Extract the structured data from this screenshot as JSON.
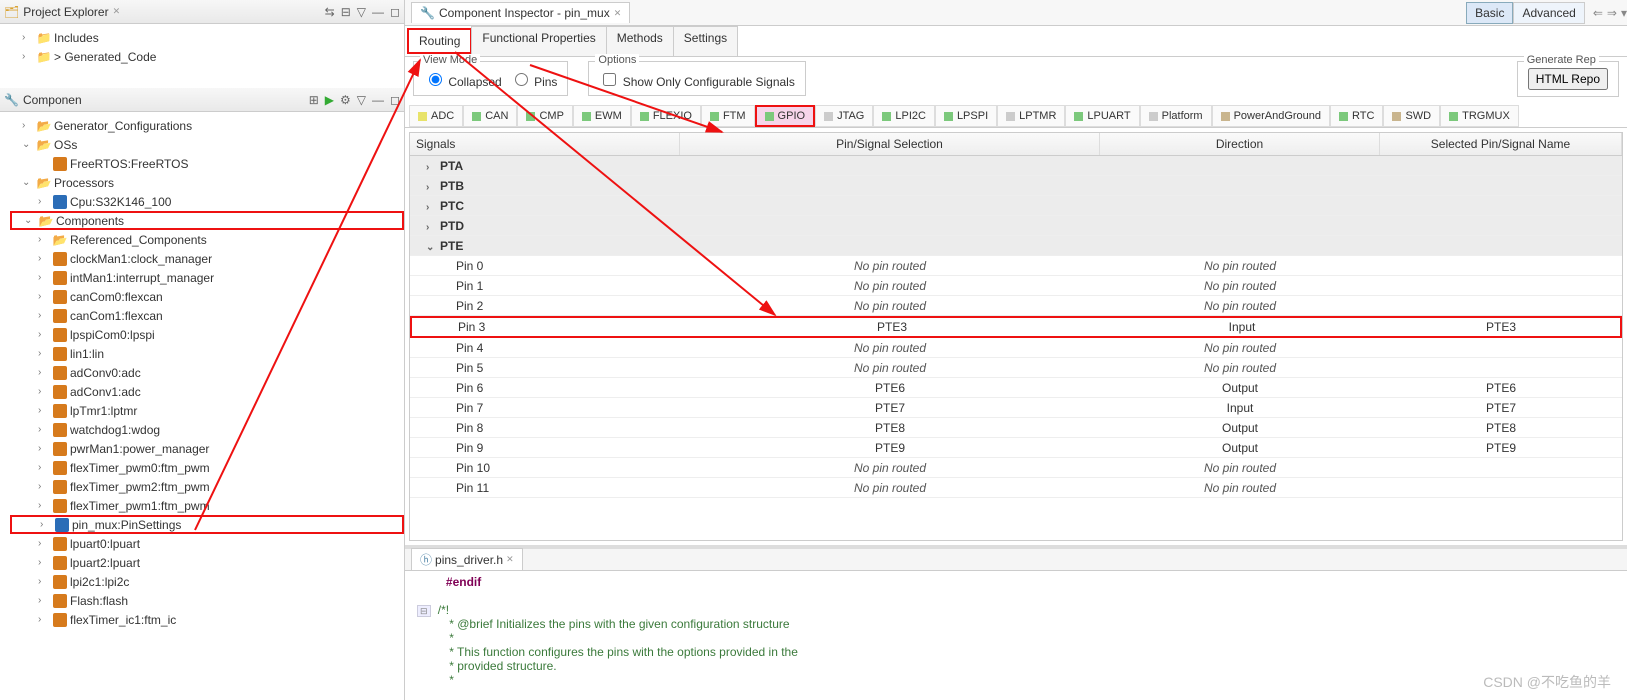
{
  "project_explorer": {
    "title": "Project Explorer",
    "items": [
      "Includes",
      "Generated_Code"
    ]
  },
  "components_view": {
    "title": "Componen",
    "tree": [
      {
        "label": "Generator_Configurations",
        "type": "folder",
        "indent": 1,
        "arrow": ">"
      },
      {
        "label": "OSs",
        "type": "folder",
        "indent": 1,
        "arrow": "v"
      },
      {
        "label": "FreeRTOS:FreeRTOS",
        "type": "comp",
        "cls": "o",
        "indent": 2,
        "arrow": ""
      },
      {
        "label": "Processors",
        "type": "folder",
        "indent": 1,
        "arrow": "v"
      },
      {
        "label": "Cpu:S32K146_100",
        "type": "comp",
        "cls": "b",
        "indent": 2,
        "arrow": ">"
      },
      {
        "label": "Components",
        "type": "folder",
        "indent": 1,
        "arrow": "v",
        "highlight": true
      },
      {
        "label": "Referenced_Components",
        "type": "folder",
        "indent": 2,
        "arrow": ">"
      },
      {
        "label": "clockMan1:clock_manager",
        "type": "comp",
        "cls": "o",
        "indent": 2,
        "arrow": ">"
      },
      {
        "label": "intMan1:interrupt_manager",
        "type": "comp",
        "cls": "o",
        "indent": 2,
        "arrow": ">"
      },
      {
        "label": "canCom0:flexcan",
        "type": "comp",
        "cls": "o",
        "indent": 2,
        "arrow": ">"
      },
      {
        "label": "canCom1:flexcan",
        "type": "comp",
        "cls": "o",
        "indent": 2,
        "arrow": ">"
      },
      {
        "label": "lpspiCom0:lpspi",
        "type": "comp",
        "cls": "o",
        "indent": 2,
        "arrow": ">"
      },
      {
        "label": "lin1:lin",
        "type": "comp",
        "cls": "o",
        "indent": 2,
        "arrow": ">"
      },
      {
        "label": "adConv0:adc",
        "type": "comp",
        "cls": "o",
        "indent": 2,
        "arrow": ">"
      },
      {
        "label": "adConv1:adc",
        "type": "comp",
        "cls": "o",
        "indent": 2,
        "arrow": ">"
      },
      {
        "label": "lpTmr1:lptmr",
        "type": "comp",
        "cls": "o",
        "indent": 2,
        "arrow": ">"
      },
      {
        "label": "watchdog1:wdog",
        "type": "comp",
        "cls": "o",
        "indent": 2,
        "arrow": ">"
      },
      {
        "label": "pwrMan1:power_manager",
        "type": "comp",
        "cls": "o",
        "indent": 2,
        "arrow": ">"
      },
      {
        "label": "flexTimer_pwm0:ftm_pwm",
        "type": "comp",
        "cls": "o",
        "indent": 2,
        "arrow": ">"
      },
      {
        "label": "flexTimer_pwm2:ftm_pwm",
        "type": "comp",
        "cls": "o",
        "indent": 2,
        "arrow": ">"
      },
      {
        "label": "flexTimer_pwm1:ftm_pwm",
        "type": "comp",
        "cls": "o",
        "indent": 2,
        "arrow": ">"
      },
      {
        "label": "pin_mux:PinSettings",
        "type": "comp",
        "cls": "b",
        "indent": 2,
        "arrow": ">",
        "highlight": true
      },
      {
        "label": "lpuart0:lpuart",
        "type": "comp",
        "cls": "o",
        "indent": 2,
        "arrow": ">"
      },
      {
        "label": "lpuart2:lpuart",
        "type": "comp",
        "cls": "o",
        "indent": 2,
        "arrow": ">"
      },
      {
        "label": "lpi2c1:lpi2c",
        "type": "comp",
        "cls": "o",
        "indent": 2,
        "arrow": ">"
      },
      {
        "label": "Flash:flash",
        "type": "comp",
        "cls": "o",
        "indent": 2,
        "arrow": ">"
      },
      {
        "label": "flexTimer_ic1:ftm_ic",
        "type": "comp",
        "cls": "o",
        "indent": 2,
        "arrow": ">"
      }
    ]
  },
  "inspector": {
    "tab_title": "Component Inspector - pin_mux",
    "mode_basic": "Basic",
    "mode_advanced": "Advanced",
    "subtabs": [
      "Routing",
      "Functional Properties",
      "Methods",
      "Settings"
    ],
    "view_mode_legend": "View Mode",
    "options_legend": "Options",
    "radio_collapsed": "Collapsed",
    "radio_pins": "Pins",
    "chk_show_only": "Show Only Configurable Signals",
    "generate_legend": "Generate Rep",
    "generate_button": "HTML Repo",
    "filter_chips": [
      {
        "label": "ADC",
        "color": "#e8e36a"
      },
      {
        "label": "CAN",
        "color": "#7cc97c"
      },
      {
        "label": "CMP",
        "color": "#7cc97c"
      },
      {
        "label": "EWM",
        "color": "#7cc97c"
      },
      {
        "label": "FLEXIO",
        "color": "#7cc97c"
      },
      {
        "label": "FTM",
        "color": "#7cc97c"
      },
      {
        "label": "GPIO",
        "color": "#7cc97c",
        "selected": true
      },
      {
        "label": "JTAG",
        "color": "#ccc"
      },
      {
        "label": "LPI2C",
        "color": "#7cc97c"
      },
      {
        "label": "LPSPI",
        "color": "#7cc97c"
      },
      {
        "label": "LPTMR",
        "color": "#ccc"
      },
      {
        "label": "LPUART",
        "color": "#7cc97c"
      },
      {
        "label": "Platform",
        "color": "#ccc"
      },
      {
        "label": "PowerAndGround",
        "color": "#c9b58e"
      },
      {
        "label": "RTC",
        "color": "#7cc97c"
      },
      {
        "label": "SWD",
        "color": "#c9b58e"
      },
      {
        "label": "TRGMUX",
        "color": "#7cc97c"
      }
    ],
    "columns": [
      "Signals",
      "Pin/Signal Selection",
      "Direction",
      "Selected Pin/Signal Name"
    ],
    "groups": [
      {
        "name": "PTA",
        "expanded": false
      },
      {
        "name": "PTB",
        "expanded": false
      },
      {
        "name": "PTC",
        "expanded": false
      },
      {
        "name": "PTD",
        "expanded": false
      },
      {
        "name": "PTE",
        "expanded": true,
        "pins": [
          {
            "name": "Pin 0",
            "sel": "No pin routed",
            "dir": "No pin routed",
            "sname": ""
          },
          {
            "name": "Pin 1",
            "sel": "No pin routed",
            "dir": "No pin routed",
            "sname": ""
          },
          {
            "name": "Pin 2",
            "sel": "No pin routed",
            "dir": "No pin routed",
            "sname": ""
          },
          {
            "name": "Pin 3",
            "sel": "PTE3",
            "dir": "Input",
            "sname": "PTE3",
            "highlight": true
          },
          {
            "name": "Pin 4",
            "sel": "No pin routed",
            "dir": "No pin routed",
            "sname": ""
          },
          {
            "name": "Pin 5",
            "sel": "No pin routed",
            "dir": "No pin routed",
            "sname": ""
          },
          {
            "name": "Pin 6",
            "sel": "PTE6",
            "dir": "Output",
            "sname": "PTE6"
          },
          {
            "name": "Pin 7",
            "sel": "PTE7",
            "dir": "Input",
            "sname": "PTE7"
          },
          {
            "name": "Pin 8",
            "sel": "PTE8",
            "dir": "Output",
            "sname": "PTE8"
          },
          {
            "name": "Pin 9",
            "sel": "PTE9",
            "dir": "Output",
            "sname": "PTE9"
          },
          {
            "name": "Pin 10",
            "sel": "No pin routed",
            "dir": "No pin routed",
            "sname": ""
          },
          {
            "name": "Pin 11",
            "sel": "No pin routed",
            "dir": "No pin routed",
            "sname": ""
          }
        ]
      }
    ]
  },
  "editor": {
    "filename": "pins_driver.h",
    "endif": "#endif",
    "comment_lines": [
      "/*!",
      " * @brief Initializes the pins with the given configuration structure",
      " *",
      " * This function configures the pins with the options provided in the",
      " * provided structure.",
      " *"
    ]
  },
  "watermark": "CSDN @不吃鱼的羊"
}
